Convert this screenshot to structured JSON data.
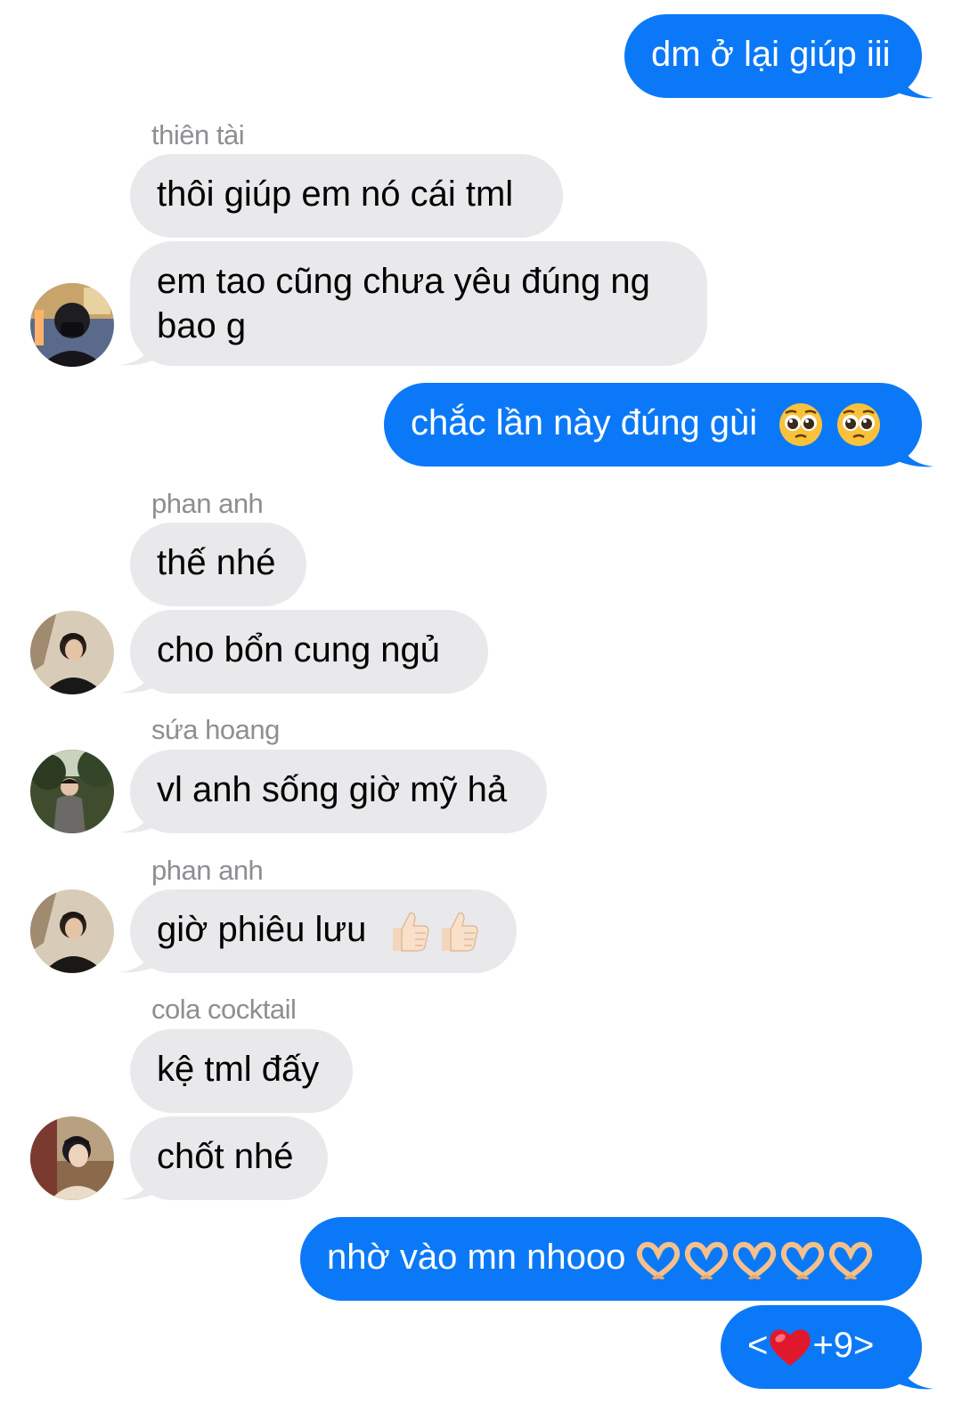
{
  "messages": [
    {
      "id": "m1",
      "direction": "outgoing",
      "text": "dm ở lại giúp iii"
    },
    {
      "id": "m2",
      "direction": "incoming",
      "sender": "thiên tài",
      "text": "thôi giúp em nó cái tml"
    },
    {
      "id": "m3",
      "direction": "incoming",
      "text": "em tao cũng chưa yêu đúng ng bao g"
    },
    {
      "id": "m4",
      "direction": "outgoing",
      "text": "chắc lần này đúng gùi",
      "emoji": "pleading-face x2"
    },
    {
      "id": "m5",
      "direction": "incoming",
      "sender": "phan anh",
      "text": "thế nhé"
    },
    {
      "id": "m6",
      "direction": "incoming",
      "text": "cho bổn cung ngủ"
    },
    {
      "id": "m7",
      "direction": "incoming",
      "sender": "sứa hoang",
      "text": "vl anh sống giờ mỹ hả"
    },
    {
      "id": "m8",
      "direction": "incoming",
      "sender": "phan anh",
      "text": "giờ phiêu lưu",
      "emoji": "thumbs-up x2"
    },
    {
      "id": "m9",
      "direction": "incoming",
      "sender": "cola cocktail",
      "text": "kệ tml đấy"
    },
    {
      "id": "m10",
      "direction": "incoming",
      "text": "chốt nhé"
    },
    {
      "id": "m11",
      "direction": "outgoing",
      "text": "nhờ vào mn nhooo",
      "emoji": "heart-hands x5"
    },
    {
      "id": "m12",
      "direction": "outgoing",
      "text_before": "<",
      "text_after": "+9>",
      "emoji": "red-heart"
    }
  ],
  "colors": {
    "outgoing_bubble": "#0b79f7",
    "incoming_bubble": "#e9e9eb",
    "sender_label": "#8e8e93",
    "background": "#ffffff"
  },
  "icons": [
    "pleading-face-icon",
    "thumbs-up-icon",
    "heart-hands-icon",
    "red-heart-icon"
  ]
}
